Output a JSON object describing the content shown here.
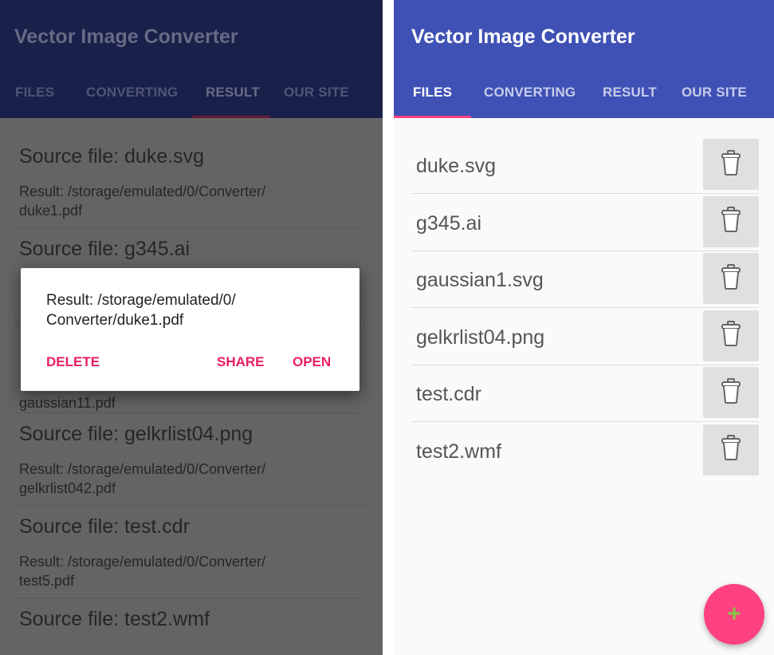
{
  "app_title": "Vector Image Converter",
  "tabs": [
    "FILES",
    "CONVERTING",
    "RESULT",
    "OUR SITE"
  ],
  "colors": {
    "primary": "#3f51b5",
    "accent": "#ff4081",
    "dialog_button": "#e91e63",
    "fab_icon": "#8bc34a"
  },
  "left": {
    "active_tab": "RESULT",
    "results": [
      {
        "source": "Source file: duke.svg",
        "result_line1": "Result: /storage/emulated/0/Converter/",
        "result_line2": "duke1.pdf"
      },
      {
        "source": "Source file: g345.ai"
      },
      {
        "result_line2": "gaussian11.pdf"
      },
      {
        "source": "Source file: gelkrlist04.png",
        "result_line1": "Result: /storage/emulated/0/Converter/",
        "result_line2": "gelkrlist042.pdf"
      },
      {
        "source": "Source file: test.cdr",
        "result_line1": "Result: /storage/emulated/0/Converter/",
        "result_line2": "test5.pdf"
      },
      {
        "source": "Source file: test2.wmf"
      }
    ],
    "dialog": {
      "message_line1": "Result: /storage/emulated/0/",
      "message_line2": "Converter/duke1.pdf",
      "delete": "DELETE",
      "share": "SHARE",
      "open": "OPEN"
    }
  },
  "right": {
    "active_tab": "FILES",
    "files": [
      "duke.svg",
      "g345.ai",
      "gaussian1.svg",
      "gelkrlist04.png",
      "test.cdr",
      "test2.wmf"
    ],
    "delete_icon": "trash-icon",
    "fab_icon": "plus-icon",
    "fab_label": "+"
  }
}
